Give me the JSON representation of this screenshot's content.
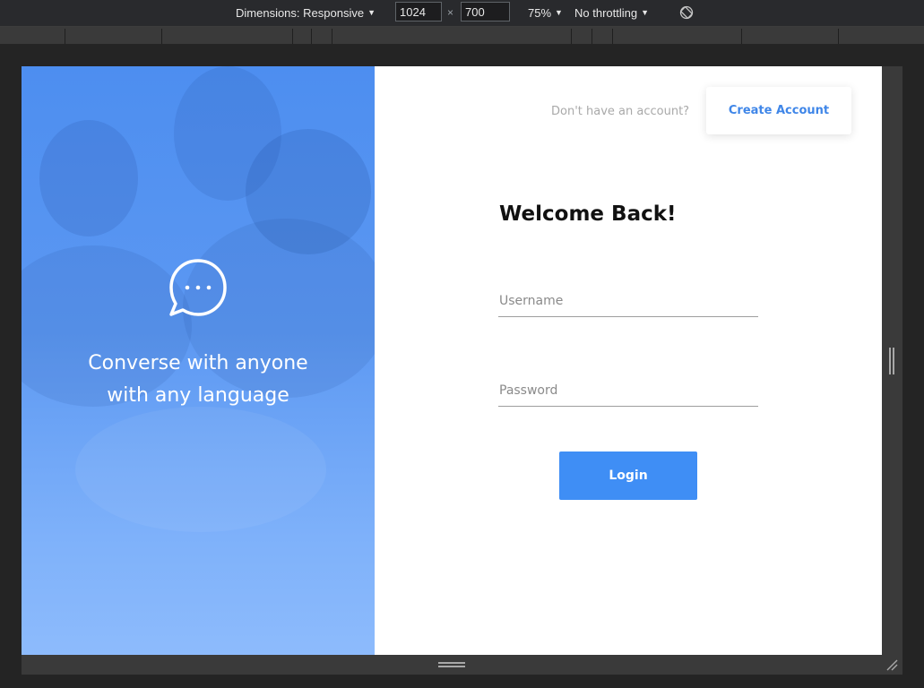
{
  "devtools": {
    "dimensions_label": "Dimensions: Responsive",
    "width": "1024",
    "height": "700",
    "times": "×",
    "zoom": "75%",
    "throttling": "No throttling",
    "rotate_icon": "rotate-icon"
  },
  "hero": {
    "icon": "chat-bubble-icon",
    "line1": "Converse with anyone",
    "line2": "with any language",
    "gradient_top": "#4d8ef0",
    "gradient_bottom": "#8dbbfc"
  },
  "header": {
    "prompt": "Don't have an account?",
    "create_account_label": "Create Account"
  },
  "form": {
    "title": "Welcome Back!",
    "username_placeholder": "Username",
    "password_placeholder": "Password",
    "login_label": "Login"
  },
  "colors": {
    "accent": "#3f8ef5",
    "link": "#3f86e8",
    "hint": "#a9a9a9"
  }
}
